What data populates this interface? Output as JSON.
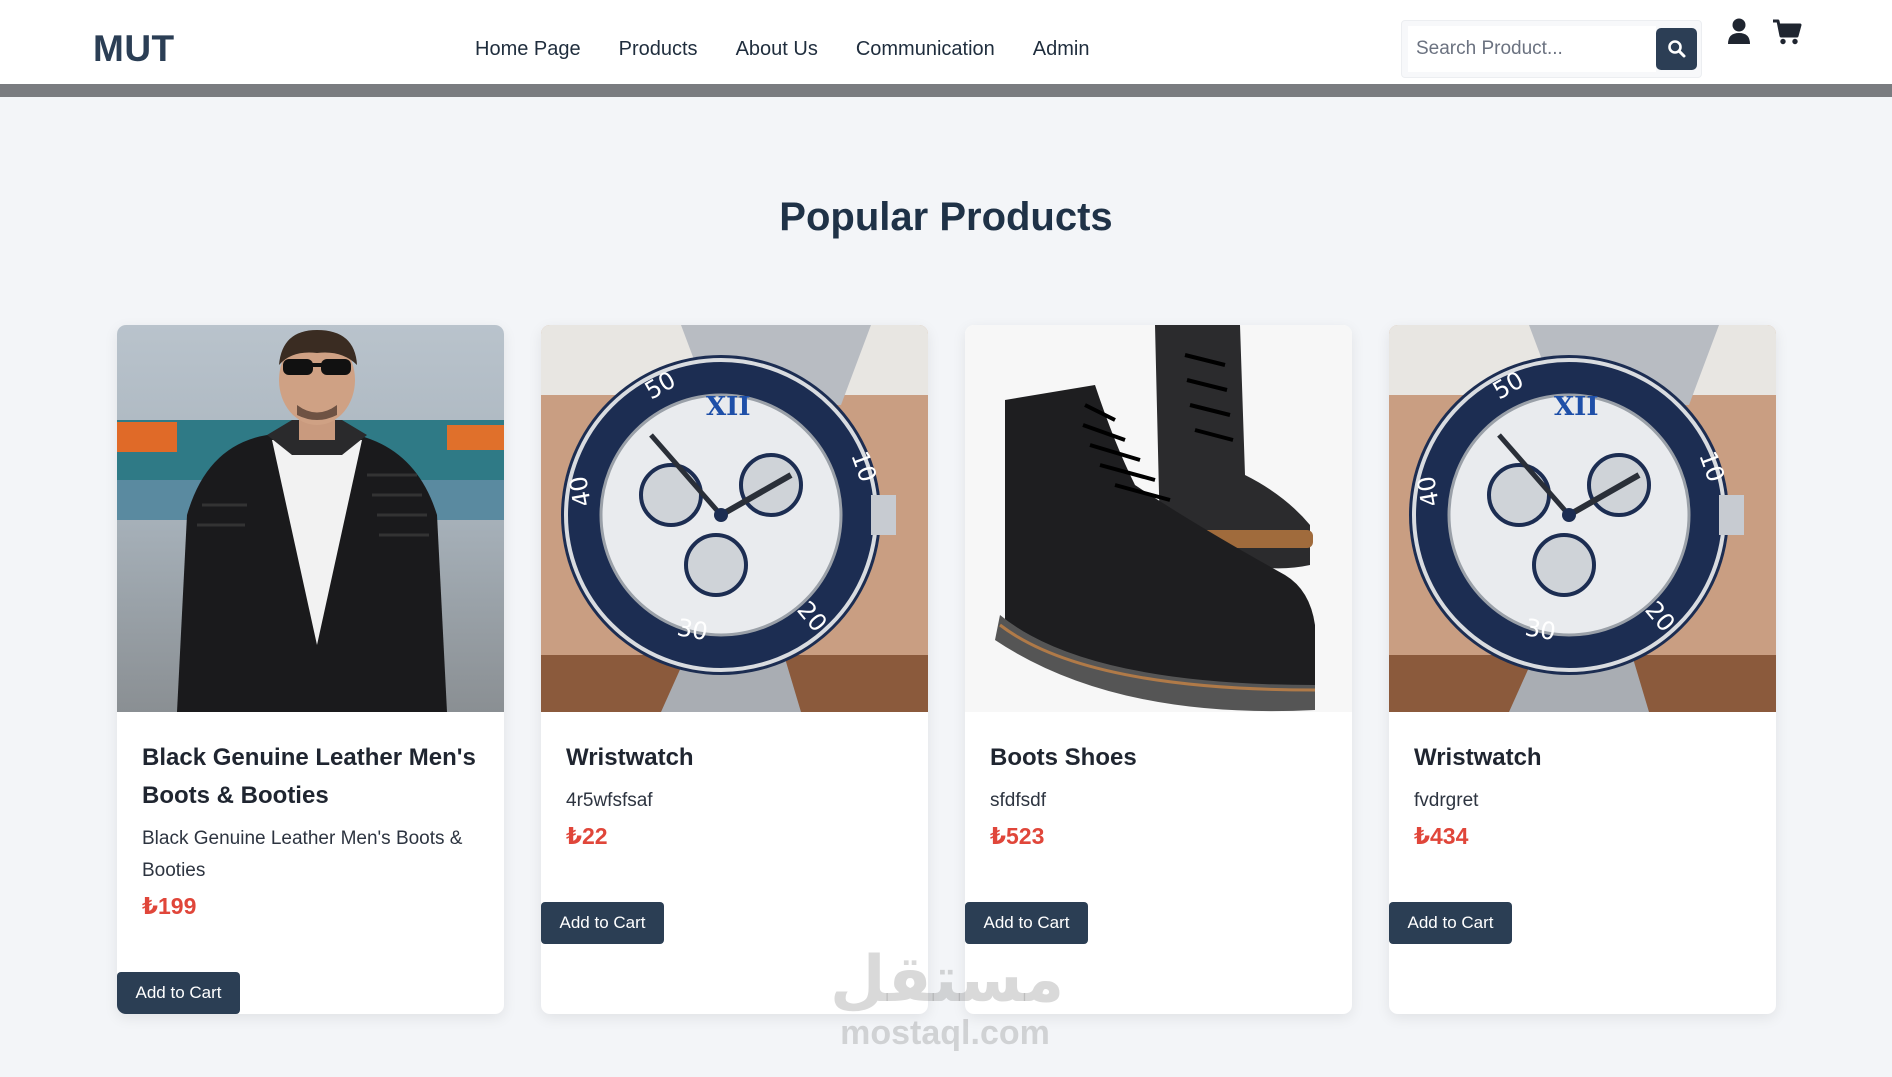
{
  "brand": "MUT",
  "nav": [
    {
      "label": "Home Page"
    },
    {
      "label": "Products"
    },
    {
      "label": "About Us"
    },
    {
      "label": "Communication"
    },
    {
      "label": "Admin"
    }
  ],
  "search": {
    "placeholder": "Search Product...",
    "value": ""
  },
  "icons": {
    "search": "search-icon",
    "user": "user-icon",
    "cart": "cart-icon"
  },
  "section_title": "Popular Products",
  "products": [
    {
      "title": "Black Genuine Leather Men's Boots & Booties",
      "description": "Black Genuine Leather Men's Boots & Booties",
      "price": "₺199",
      "button": "Add to Cart",
      "image": "man-in-leather-jacket"
    },
    {
      "title": "Wristwatch",
      "description": "4r5wfsfsaf",
      "price": "₺22",
      "button": "Add to Cart",
      "image": "wristwatch"
    },
    {
      "title": "Boots Shoes",
      "description": "sfdfsdf",
      "price": "₺523",
      "button": "Add to Cart",
      "image": "black-boots"
    },
    {
      "title": "Wristwatch",
      "description": "fvdrgret",
      "price": "₺434",
      "button": "Add to Cart",
      "image": "wristwatch"
    }
  ],
  "watermark": {
    "arabic": "مستقل",
    "latin": "mostaql.com"
  },
  "colors": {
    "primary": "#2b3e54",
    "price": "#e0463a",
    "background": "#f3f5f8"
  }
}
